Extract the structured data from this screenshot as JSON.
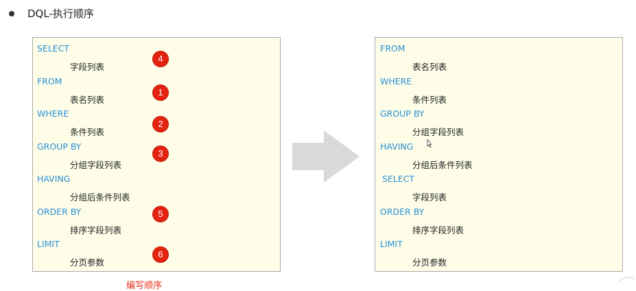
{
  "heading": {
    "title": "DQL-执行顺序"
  },
  "left_panel": {
    "lines": [
      {
        "text": "SELECT",
        "kind": "keyword"
      },
      {
        "text": "字段列表",
        "kind": "item"
      },
      {
        "text": "FROM",
        "kind": "keyword"
      },
      {
        "text": "表名列表",
        "kind": "item"
      },
      {
        "text": "WHERE",
        "kind": "keyword"
      },
      {
        "text": "条件列表",
        "kind": "item"
      },
      {
        "text": "GROUP  BY",
        "kind": "keyword"
      },
      {
        "text": "分组字段列表",
        "kind": "item"
      },
      {
        "text": "HAVING",
        "kind": "keyword"
      },
      {
        "text": "分组后条件列表",
        "kind": "item"
      },
      {
        "text": "ORDER BY",
        "kind": "keyword"
      },
      {
        "text": "排序字段列表",
        "kind": "item"
      },
      {
        "text": "LIMIT",
        "kind": "keyword"
      },
      {
        "text": "分页参数",
        "kind": "item"
      }
    ],
    "order_badges": [
      "4",
      "1",
      "2",
      "3",
      "5",
      "6"
    ]
  },
  "right_panel": {
    "lines": [
      {
        "text": "FROM",
        "kind": "keyword"
      },
      {
        "text": "表名列表",
        "kind": "item"
      },
      {
        "text": "WHERE",
        "kind": "keyword"
      },
      {
        "text": "条件列表",
        "kind": "item"
      },
      {
        "text": "GROUP  BY",
        "kind": "keyword"
      },
      {
        "text": "分组字段列表",
        "kind": "item"
      },
      {
        "text": "HAVING",
        "kind": "keyword"
      },
      {
        "text": "分组后条件列表",
        "kind": "item"
      },
      {
        "text": "SELECT",
        "kind": "keyword"
      },
      {
        "text": "字段列表",
        "kind": "item"
      },
      {
        "text": "ORDER BY",
        "kind": "keyword"
      },
      {
        "text": "排序字段列表",
        "kind": "item"
      },
      {
        "text": "LIMIT",
        "kind": "keyword"
      },
      {
        "text": "分页参数",
        "kind": "item"
      }
    ]
  },
  "footer": {
    "caption": "编写顺序"
  },
  "colors": {
    "keyword": "#2a8fd6",
    "badge": "#e3220f",
    "panel_bg": "#fdfde8",
    "arrow": "#d9d9d9",
    "caption": "#e5331e"
  },
  "icons": {
    "arrow": "right-arrow-icon",
    "cursor": "mouse-cursor-icon"
  }
}
